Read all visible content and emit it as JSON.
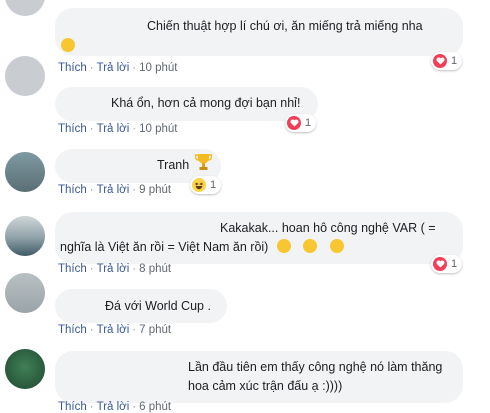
{
  "actions": {
    "like": "Thích",
    "reply": "Trả lời"
  },
  "colors": {
    "heart": "#f33e58",
    "haha": "#fcd34a",
    "link": "#385898"
  },
  "comments": [
    {
      "line1": "Chiến thuật hợp lí chú ơi, ăn miếng trả miếng nha",
      "time": "10 phút",
      "reaction_count": "1",
      "reaction": "heart-icon"
    },
    {
      "line1": "Khá ổn, hơn cả mong đợi bạn nhỉ!",
      "time": "10 phút",
      "reaction_count": "1",
      "reaction": "heart-icon"
    },
    {
      "line1": "Tranh",
      "time": "9 phút",
      "reaction_count": "1",
      "reaction": "haha-icon"
    },
    {
      "line1": "Kakakak... hoan hô công nghệ VAR ( =",
      "line2": "nghĩa là Việt ăn rồi = Việt Nam ăn rồi)",
      "time": "8 phút",
      "reaction_count": "1",
      "reaction": "heart-icon"
    },
    {
      "line1": "Đá với World Cup .",
      "time": "7 phút"
    },
    {
      "line1": "Lần đầu tiên em thấy công nghệ nó làm thăng",
      "line2": "hoa cảm xúc trận đấu ạ :))))",
      "time": "6 phút"
    }
  ]
}
